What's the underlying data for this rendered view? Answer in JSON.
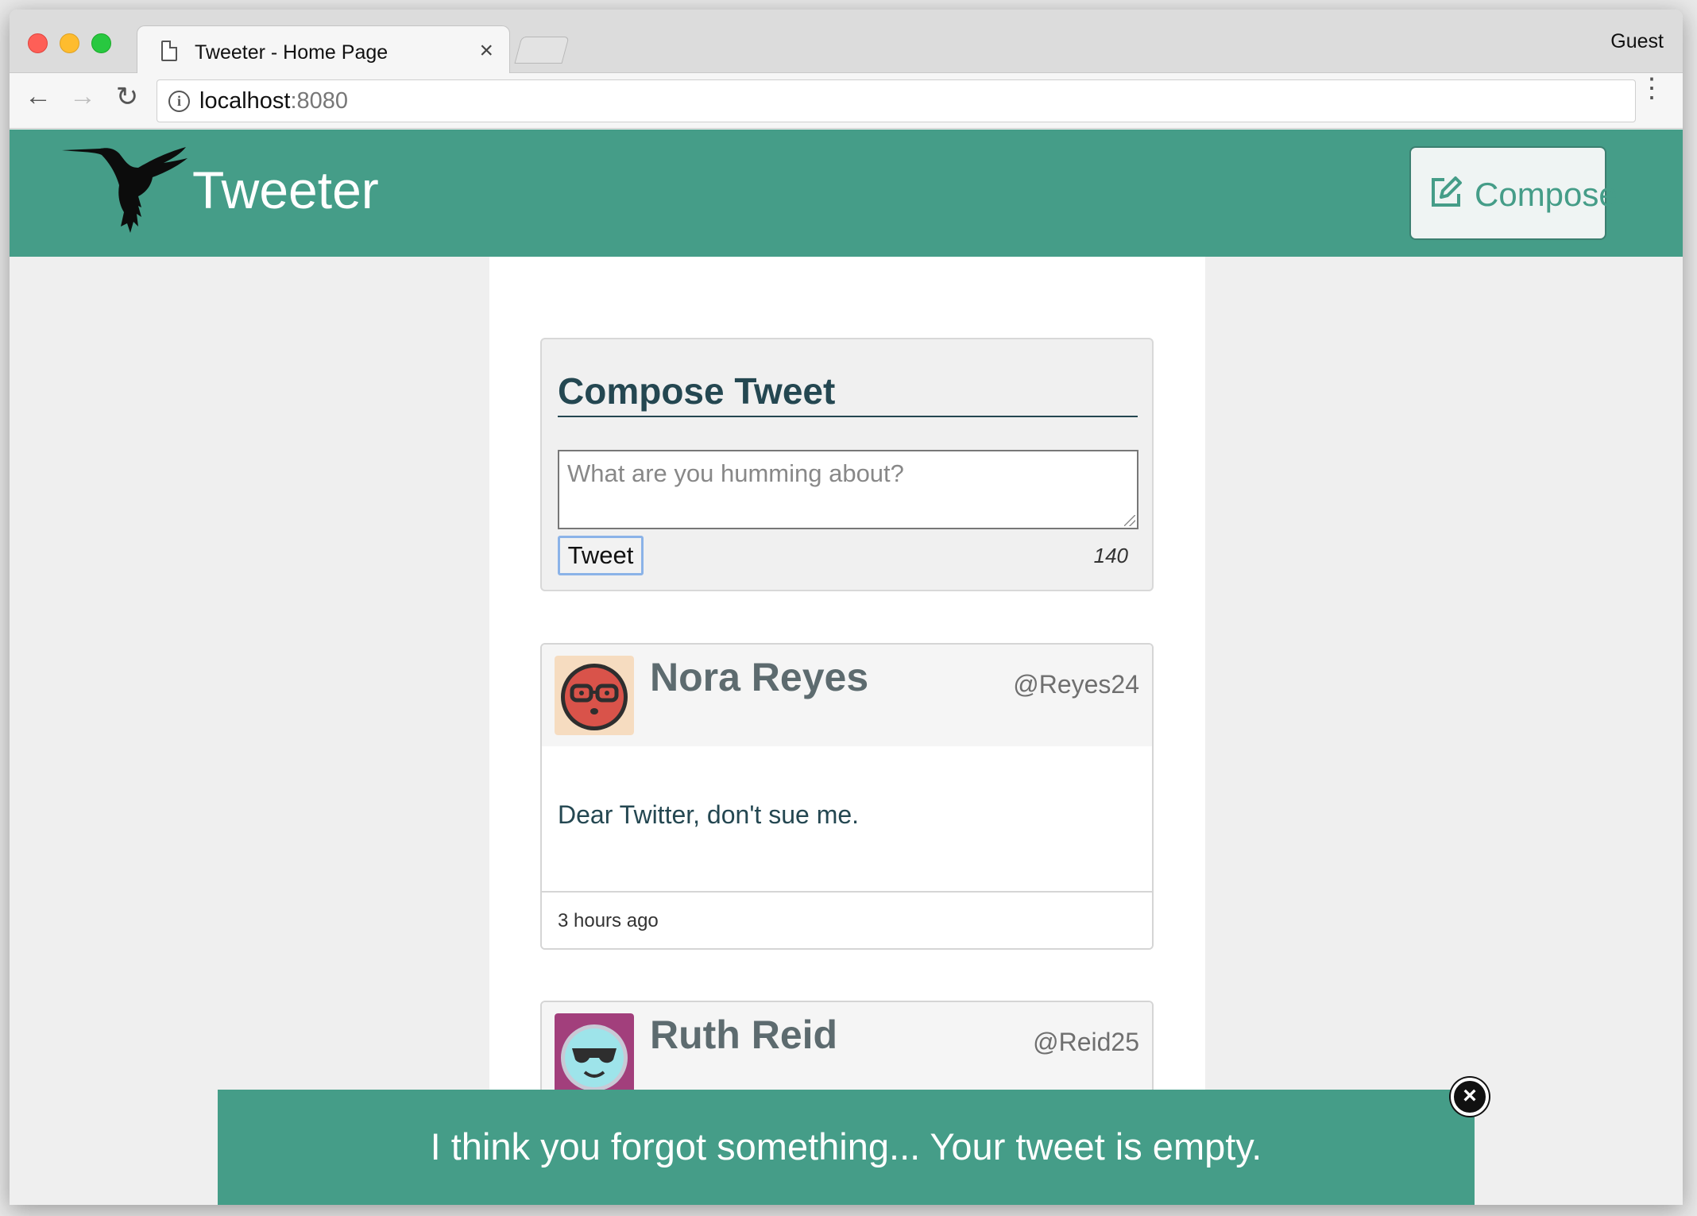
{
  "browser": {
    "tab_title": "Tweeter - Home Page",
    "tab_close": "×",
    "profile": "Guest",
    "url_host": "localhost",
    "url_port": ":8080",
    "back_icon": "←",
    "forward_icon": "→",
    "reload_icon": "↻",
    "menu_icon": "⋮",
    "info_icon": "i"
  },
  "header": {
    "brand": "Tweeter",
    "compose_label": "Compose",
    "background_color": "#459d88"
  },
  "compose": {
    "heading": "Compose Tweet",
    "placeholder": "What are you humming about?",
    "button_label": "Tweet",
    "counter": "140"
  },
  "tweets": [
    {
      "name": "Nora Reyes",
      "handle": "@Reyes24",
      "content": "Dear Twitter, don't sue me.",
      "time": "3 hours ago",
      "avatar_bg": "#f6dcc0",
      "avatar_face": "#d9534a"
    },
    {
      "name": "Ruth Reid",
      "handle": "@Reid25",
      "avatar_bg": "#a23f7c",
      "avatar_face": "#9ee4ea"
    }
  ],
  "flash": {
    "message": "I think you forgot something... Your tweet is empty.",
    "close_icon": "×"
  }
}
